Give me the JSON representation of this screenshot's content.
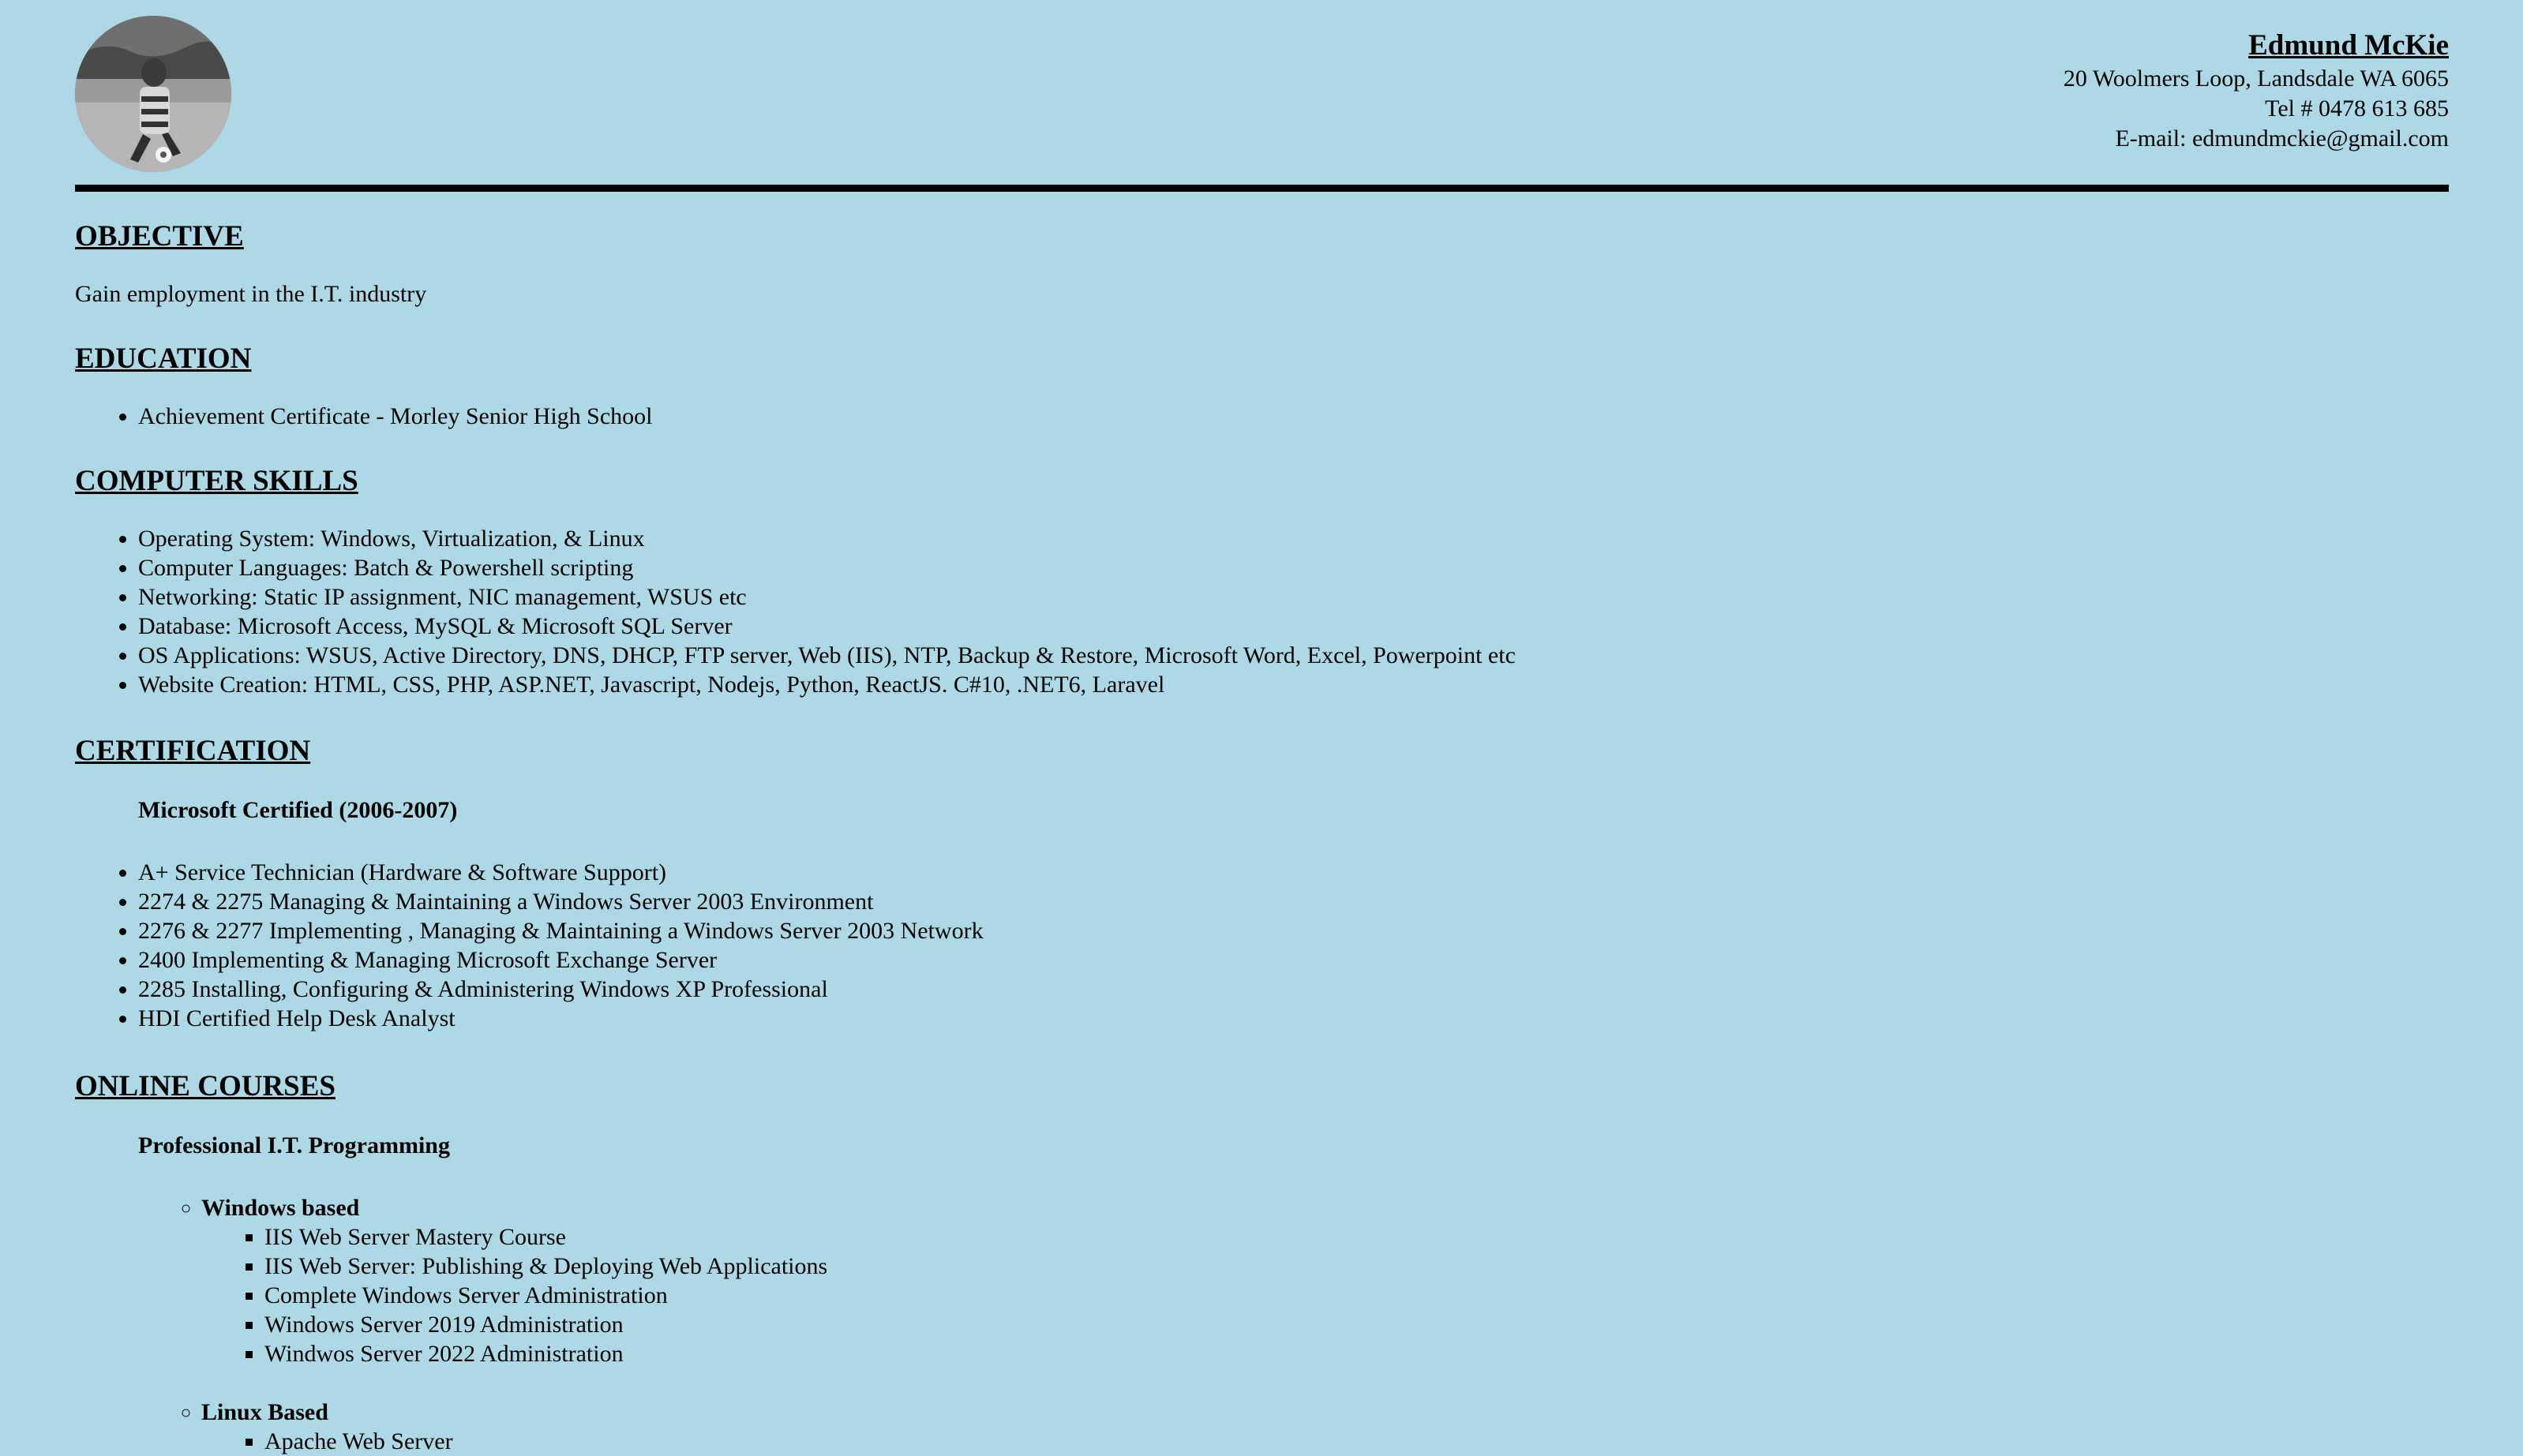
{
  "header": {
    "name": "Edmund McKie",
    "address": "20 Woolmers Loop, Landsdale WA 6065",
    "phone": "Tel # 0478 613 685",
    "email": "E-mail: edmundmckie@gmail.com",
    "avatar_icon": "profile-photo-soccer-player"
  },
  "objective": {
    "heading": "OBJECTIVE",
    "text": "Gain employment in the I.T. industry"
  },
  "education": {
    "heading": "EDUCATION",
    "items": [
      "Achievement Certificate - Morley Senior High School"
    ]
  },
  "computer_skills": {
    "heading": "COMPUTER SKILLS",
    "items": [
      "Operating System: Windows, Virtualization, & Linux",
      "Computer Languages: Batch & Powershell scripting",
      "Networking: Static IP assignment, NIC management, WSUS etc",
      "Database: Microsoft Access, MySQL & Microsoft SQL Server",
      "OS Applications: WSUS, Active Directory, DNS, DHCP, FTP server, Web (IIS), NTP, Backup & Restore, Microsoft Word, Excel, Powerpoint etc",
      "Website Creation: HTML, CSS, PHP, ASP.NET, Javascript, Nodejs, Python, ReactJS. C#10, .NET6, Laravel"
    ]
  },
  "certification": {
    "heading": "CERTIFICATION",
    "subtitle": "Microsoft Certified (2006-2007)",
    "items": [
      "A+ Service Technician (Hardware & Software Support)",
      "2274 & 2275 Managing & Maintaining a Windows Server 2003 Environment",
      "2276 & 2277 Implementing , Managing & Maintaining a Windows Server 2003 Network",
      "2400 Implementing & Managing Microsoft Exchange Server",
      "2285 Installing, Configuring & Administering Windows XP Professional",
      "HDI Certified Help Desk Analyst"
    ]
  },
  "online_courses": {
    "heading": "ONLINE COURSES",
    "subtitle": "Professional I.T. Programming",
    "groups": [
      {
        "title": "Windows based",
        "items": [
          "IIS Web Server Mastery Course",
          "IIS Web Server: Publishing & Deploying Web Applications",
          "Complete Windows Server Administration",
          "Windows Server 2019 Administration",
          "Windwos Server 2022 Administration"
        ]
      },
      {
        "title": "Linux Based",
        "items": [
          "Apache Web Server"
        ]
      }
    ]
  }
}
